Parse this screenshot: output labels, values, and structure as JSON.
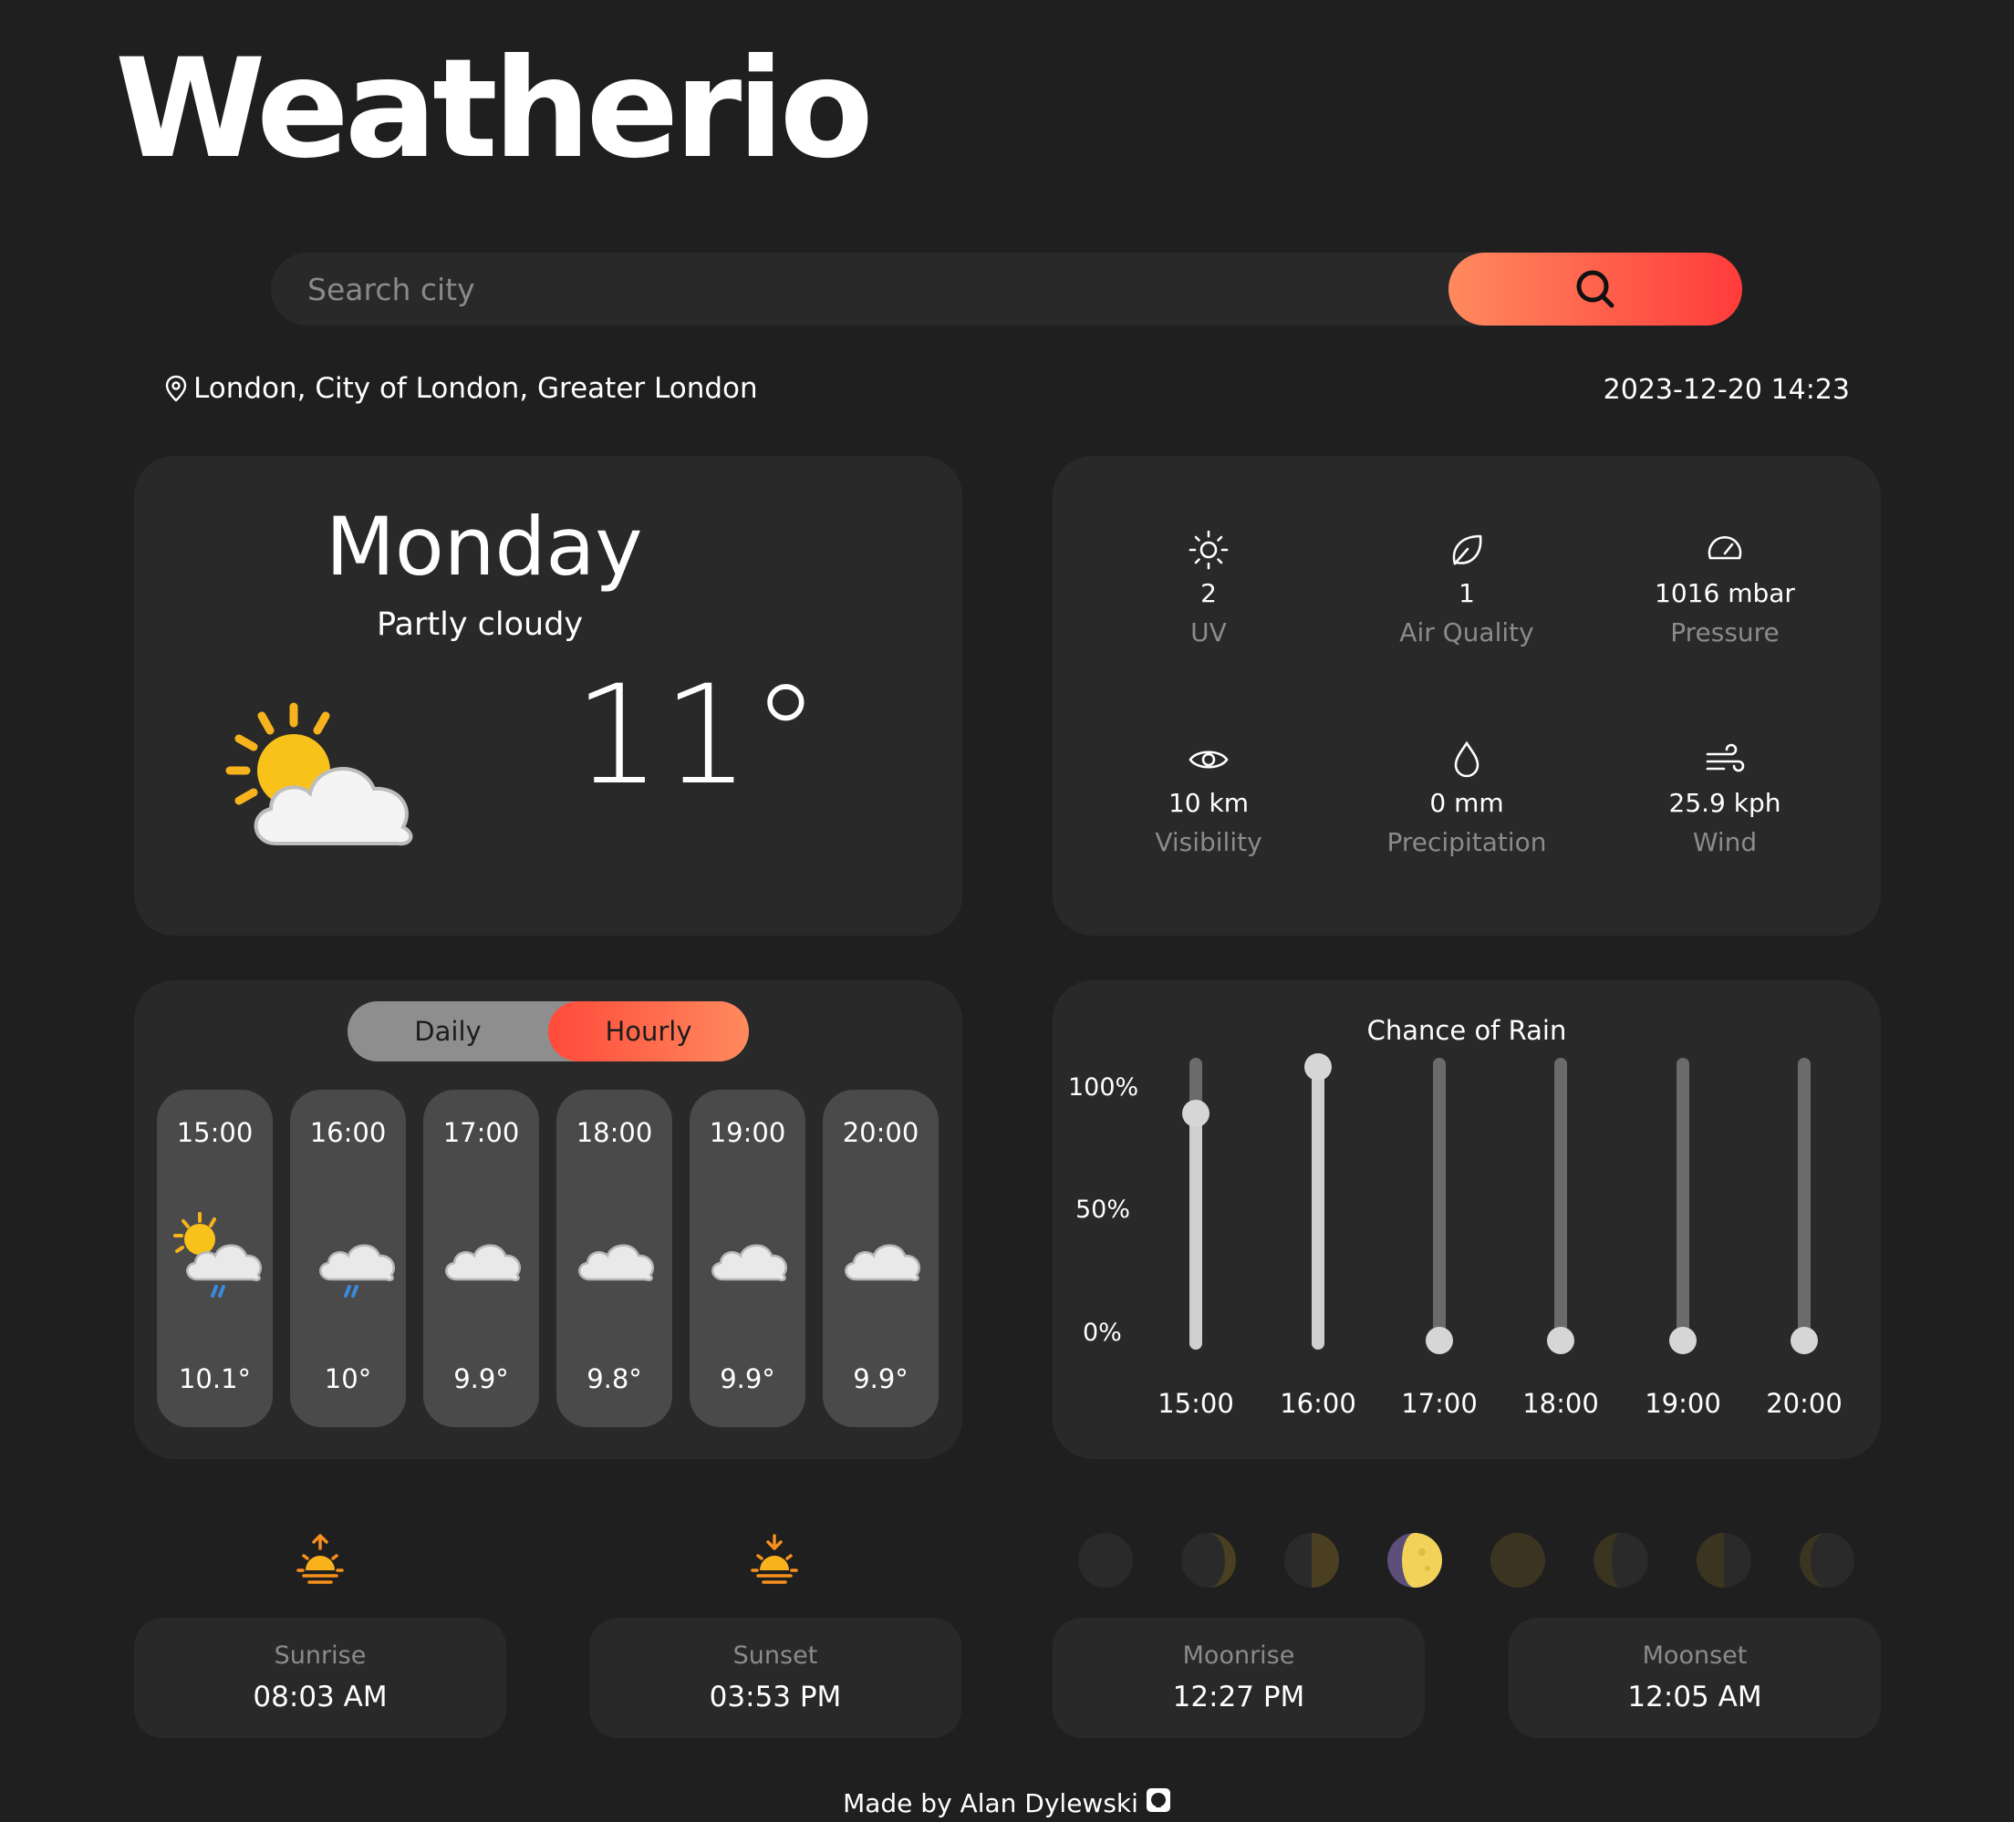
{
  "app": {
    "title": "Weatherio"
  },
  "search": {
    "placeholder": "Search city"
  },
  "location": {
    "text": "London, City of London, Greater London",
    "datetime": "2023-12-20 14:23"
  },
  "today": {
    "day": "Monday",
    "condition": "Partly cloudy",
    "temperature": "11°",
    "icon": "partly-cloudy-icon"
  },
  "details": [
    {
      "icon": "sun-icon",
      "value": "2",
      "label": "UV"
    },
    {
      "icon": "leaf-icon",
      "value": "1",
      "label": "Air Quality"
    },
    {
      "icon": "gauge-icon",
      "value": "1016 mbar",
      "label": "Pressure"
    },
    {
      "icon": "eye-icon",
      "value": "10 km",
      "label": "Visibility"
    },
    {
      "icon": "droplet-icon",
      "value": "0 mm",
      "label": "Precipitation"
    },
    {
      "icon": "wind-icon",
      "value": "25.9 kph",
      "label": "Wind"
    }
  ],
  "forecast": {
    "toggle": {
      "daily": "Daily",
      "hourly": "Hourly",
      "active": "hourly"
    },
    "hours": [
      {
        "time": "15:00",
        "temp": "10.1°",
        "icon": "sun-cloud-rain-icon"
      },
      {
        "time": "16:00",
        "temp": "10°",
        "icon": "moon-cloud-rain-icon"
      },
      {
        "time": "17:00",
        "temp": "9.9°",
        "icon": "cloud-icon"
      },
      {
        "time": "18:00",
        "temp": "9.8°",
        "icon": "cloud-icon"
      },
      {
        "time": "19:00",
        "temp": "9.9°",
        "icon": "cloud-icon"
      },
      {
        "time": "20:00",
        "temp": "9.9°",
        "icon": "cloud-icon"
      }
    ]
  },
  "chart_data": {
    "type": "bar",
    "title": "Chance of Rain",
    "categories": [
      "15:00",
      "16:00",
      "17:00",
      "18:00",
      "19:00",
      "20:00"
    ],
    "values": [
      83,
      100,
      0,
      0,
      0,
      0
    ],
    "yticks": [
      "100%",
      "50%",
      "0%"
    ],
    "ylim": [
      0,
      100
    ]
  },
  "sun_moon": [
    {
      "icon": "sunrise-icon",
      "label": "Sunrise",
      "value": "08:03 AM"
    },
    {
      "icon": "sunset-icon",
      "label": "Sunset",
      "value": "03:53 PM"
    },
    {
      "label": "Moonrise",
      "value": "12:27 PM"
    },
    {
      "label": "Moonset",
      "value": "12:05 AM"
    }
  ],
  "moon_phases": {
    "count": 8,
    "active_index": 3
  },
  "colors": {
    "background": "#1f1f1f",
    "card": "#292929",
    "accent_start": "#ff8a5e",
    "accent_end": "#ff3b3b",
    "muted": "#8b8b8b"
  },
  "footer": {
    "text": "Made by Alan Dylewski",
    "icon": "github-icon"
  }
}
